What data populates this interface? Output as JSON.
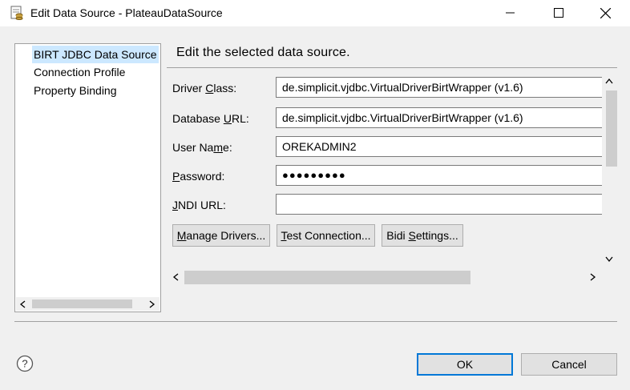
{
  "window": {
    "title": "Edit Data Source - PlateauDataSource"
  },
  "tree": {
    "items": [
      {
        "label": "BIRT JDBC Data Source",
        "selected": true
      },
      {
        "label": "Connection Profile",
        "selected": false
      },
      {
        "label": "Property Binding",
        "selected": false
      }
    ]
  },
  "page": {
    "heading": "Edit the selected data source."
  },
  "form": {
    "driver_class": {
      "label_pre": "Driver ",
      "label_key": "C",
      "label_post": "lass:",
      "value": "de.simplicit.vjdbc.VirtualDriverBirtWrapper (v1.6)"
    },
    "database_url": {
      "label_pre": "Database ",
      "label_key": "U",
      "label_post": "RL:",
      "value": "de.simplicit.vjdbc.VirtualDriverBirtWrapper (v1.6)"
    },
    "user_name": {
      "label_pre": "User Na",
      "label_key": "m",
      "label_post": "e:",
      "value": "OREKADMIN2"
    },
    "password": {
      "label_pre": "",
      "label_key": "P",
      "label_post": "assword:",
      "value": "●●●●●●●●●"
    },
    "jndi_url": {
      "label_pre": "",
      "label_key": "J",
      "label_post": "NDI URL:",
      "value": ""
    }
  },
  "actions": {
    "manage_drivers": {
      "pre": "",
      "key": "M",
      "post": "anage Drivers..."
    },
    "test_connection": {
      "pre": "",
      "key": "T",
      "post": "est Connection..."
    },
    "bidi_settings": {
      "pre": "Bidi ",
      "key": "S",
      "post": "ettings..."
    }
  },
  "footer": {
    "ok_label": "OK",
    "cancel_label": "Cancel",
    "help_glyph": "?"
  },
  "colors": {
    "selection": "#cce8ff",
    "default_button_border": "#0078d7"
  }
}
